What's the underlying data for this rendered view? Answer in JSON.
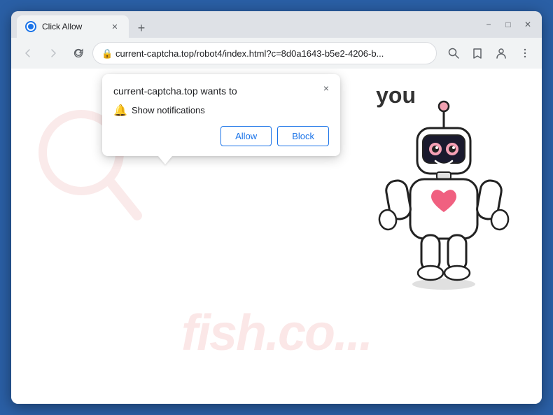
{
  "browser": {
    "tab": {
      "title": "Click Allow",
      "favicon": "globe"
    },
    "window_controls": {
      "minimize": "−",
      "maximize": "□",
      "close": "✕"
    },
    "nav": {
      "back": "←",
      "forward": "→",
      "refresh": "↻",
      "url": "current-captcha.top/robot4/index.html?c=8d0a1643-b5e2-4206-b...",
      "lock": "🔒"
    }
  },
  "popup": {
    "title": "current-captcha.top wants to",
    "permission_label": "Show notifications",
    "allow_label": "Allow",
    "block_label": "Block",
    "close_label": "×"
  },
  "page": {
    "you_text": "you",
    "watermark": "fish.co..."
  }
}
